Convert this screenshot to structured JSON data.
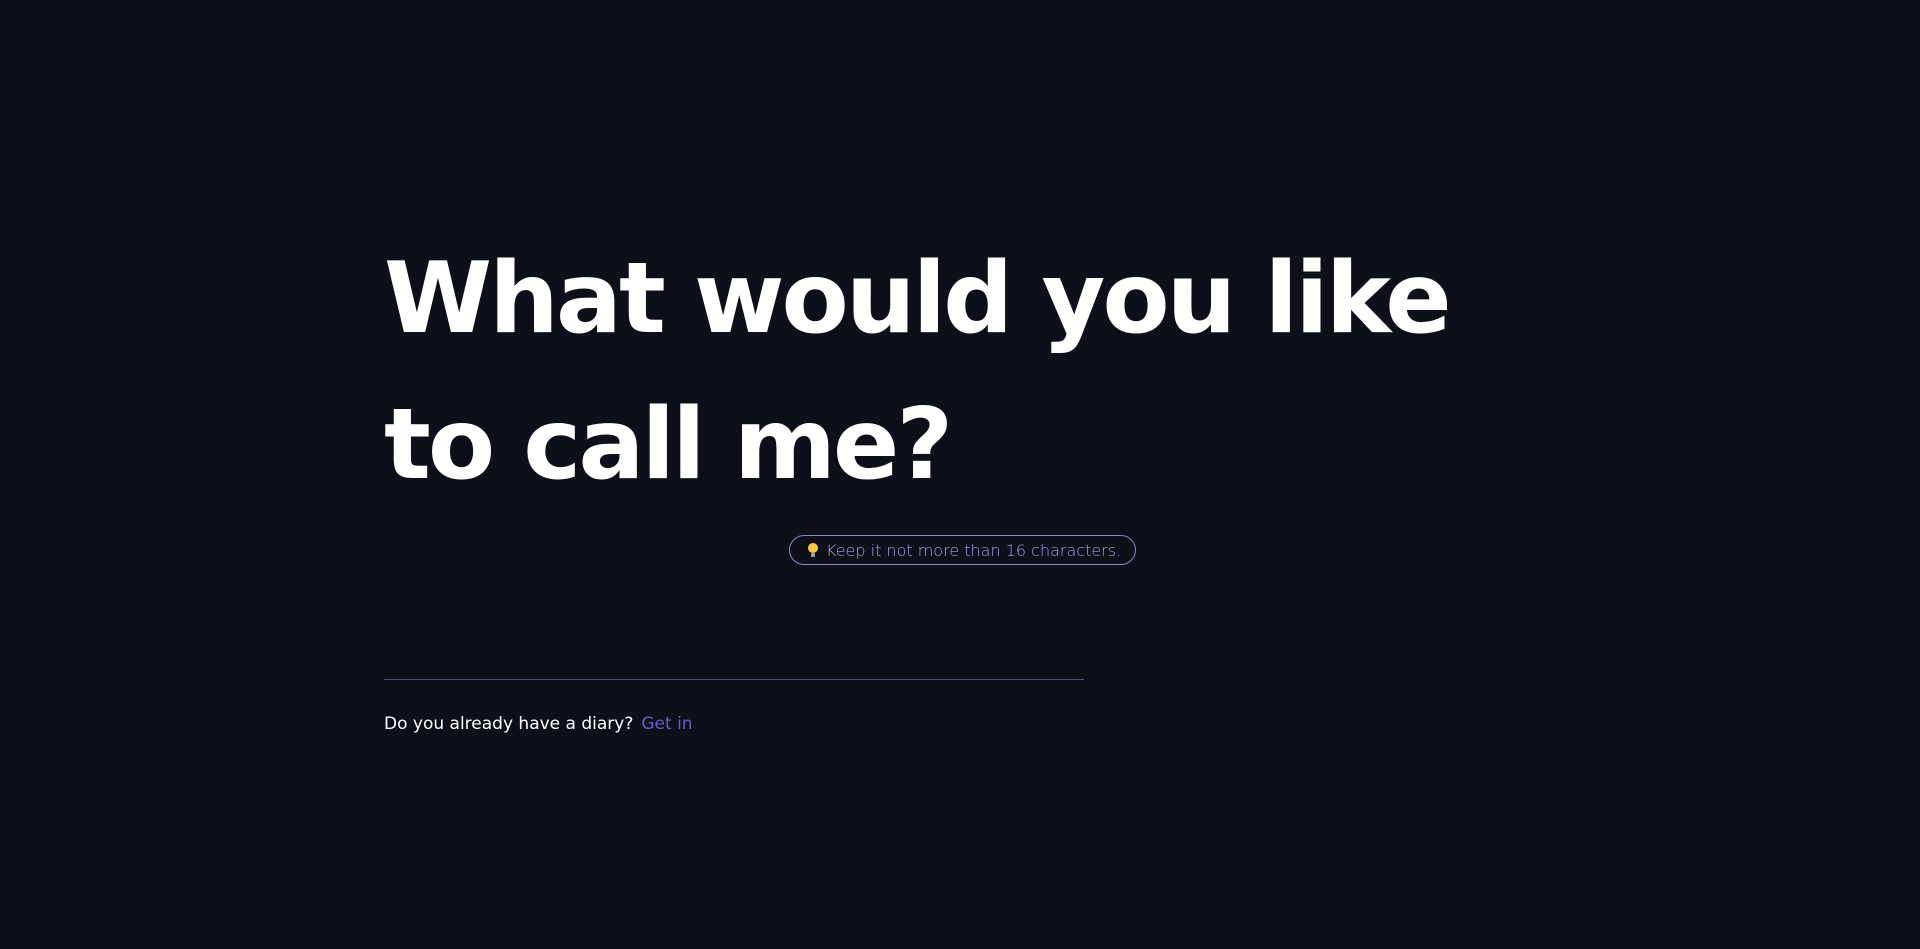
{
  "headline": "What would you like to call me?",
  "hint": {
    "icon": "lightbulb-icon",
    "text": "Keep it not more than 16 characters."
  },
  "name_input": {
    "value": "",
    "placeholder": ""
  },
  "login": {
    "question": "Do you already have a diary?",
    "link_label": "Get in"
  },
  "colors": {
    "background": "#0d1019",
    "accent": "#6a5acd",
    "hint_text": "#a79cf0",
    "hint_border": "#8b86c9",
    "input_underline": "#4c4f84"
  }
}
